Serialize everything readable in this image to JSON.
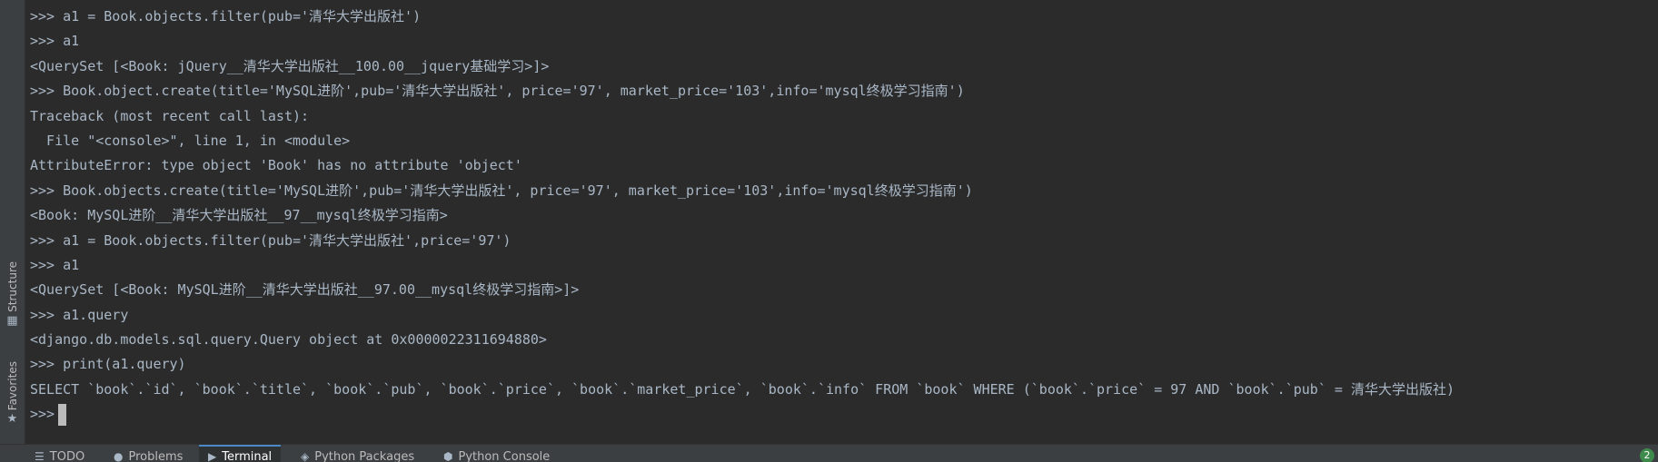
{
  "sidebar": {
    "structure_label": "Structure",
    "structure_icon": "structure-icon",
    "favorites_label": "Favorites",
    "favorites_icon": "star-icon"
  },
  "console": {
    "lines": [
      ">>> a1 = Book.objects.filter(pub='清华大学出版社')",
      ">>> a1",
      "<QuerySet [<Book: jQuery__清华大学出版社__100.00__jquery基础学习>]>",
      ">>> Book.object.create(title='MySQL进阶',pub='清华大学出版社', price='97', market_price='103',info='mysql终极学习指南')",
      "Traceback (most recent call last):",
      "  File \"<console>\", line 1, in <module>",
      "AttributeError: type object 'Book' has no attribute 'object'",
      ">>> Book.objects.create(title='MySQL进阶',pub='清华大学出版社', price='97', market_price='103',info='mysql终极学习指南')",
      "<Book: MySQL进阶__清华大学出版社__97__mysql终极学习指南>",
      ">>> a1 = Book.objects.filter(pub='清华大学出版社',price='97')",
      ">>> a1",
      "<QuerySet [<Book: MySQL进阶__清华大学出版社__97.00__mysql终极学习指南>]>",
      ">>> a1.query",
      "<django.db.models.sql.query.Query object at 0x0000022311694880>",
      ">>> print(a1.query)",
      "SELECT `book`.`id`, `book`.`title`, `book`.`pub`, `book`.`price`, `book`.`market_price`, `book`.`info` FROM `book` WHERE (`book`.`price` = 97 AND `book`.`pub` = 清华大学出版社)"
    ],
    "prompt": ">>>"
  },
  "bottom_tabs": [
    {
      "label": "TODO",
      "icon": "list-icon"
    },
    {
      "label": "Problems",
      "icon": "warning-icon"
    },
    {
      "label": "Terminal",
      "icon": "terminal-icon",
      "active": true
    },
    {
      "label": "Python Packages",
      "icon": "packages-icon"
    },
    {
      "label": "Python Console",
      "icon": "python-icon"
    }
  ],
  "status": {
    "badge": "2"
  },
  "colors": {
    "background": "#2b2b2b",
    "text": "#a9b7c6",
    "panel": "#3c3f41",
    "accent": "#4a88c7"
  }
}
